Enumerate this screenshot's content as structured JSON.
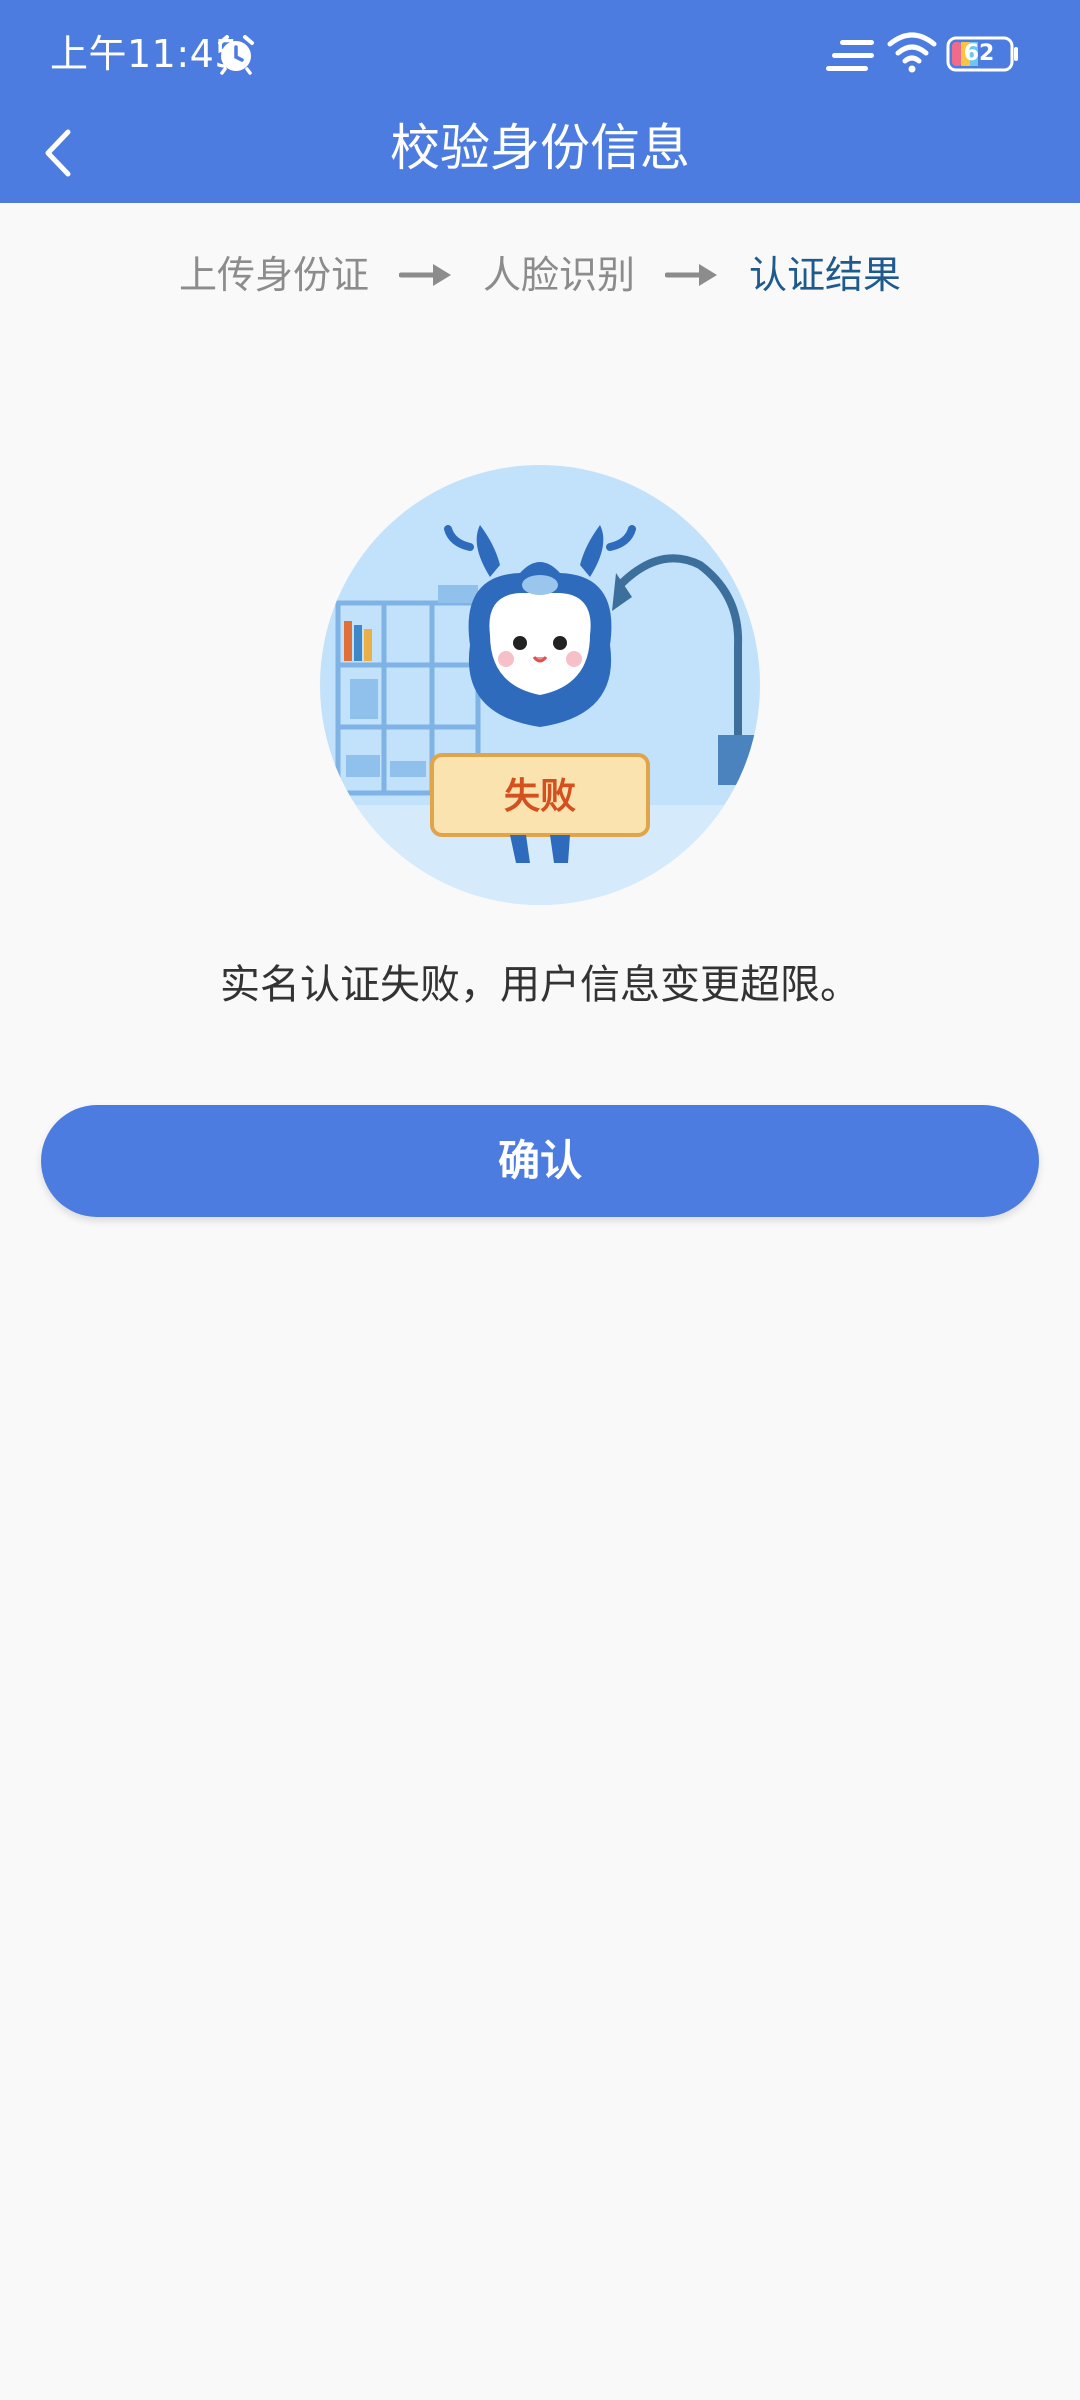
{
  "status_bar": {
    "time": "上午11:45",
    "battery": "62",
    "icons": [
      "alarm-icon",
      "signal-icon",
      "wifi-icon",
      "battery-icon"
    ]
  },
  "header": {
    "title": "校验身份信息",
    "back_icon": "chevron-left-icon"
  },
  "steps": [
    {
      "label": "上传身份证",
      "state": "done"
    },
    {
      "label": "人脸识别",
      "state": "done"
    },
    {
      "label": "认证结果",
      "state": "active"
    }
  ],
  "illustration": {
    "badge_text": "失败"
  },
  "result": {
    "message": "实名认证失败，用户信息变更超限。"
  },
  "actions": {
    "confirm_label": "确认"
  },
  "colors": {
    "primary": "#4d7ce0",
    "active_step": "#1f5a8f",
    "inactive_step": "#8c8c8c",
    "background": "#f9f9f9",
    "badge_text": "#d4501e"
  }
}
